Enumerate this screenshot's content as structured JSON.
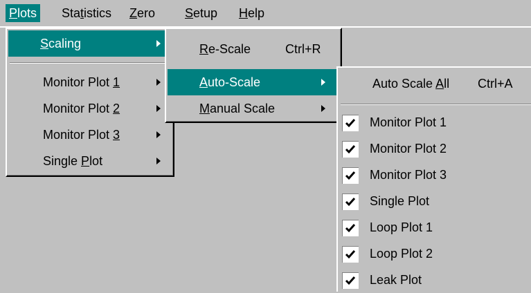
{
  "menubar": {
    "items": [
      {
        "pre": "",
        "acc": "P",
        "post": "lots"
      },
      {
        "pre": "Sta",
        "acc": "t",
        "post": "istics"
      },
      {
        "pre": "",
        "acc": "Z",
        "post": "ero"
      },
      {
        "pre": "",
        "acc": "S",
        "post": "etup"
      },
      {
        "pre": "",
        "acc": "H",
        "post": "elp"
      }
    ]
  },
  "plots_menu": {
    "scaling": {
      "pre": "",
      "acc": "S",
      "post": "caling"
    },
    "items": [
      {
        "pre": "Monitor Plot ",
        "acc": "1",
        "post": ""
      },
      {
        "pre": "Monitor Plot ",
        "acc": "2",
        "post": ""
      },
      {
        "pre": "Monitor Plot ",
        "acc": "3",
        "post": ""
      },
      {
        "pre": "Single ",
        "acc": "P",
        "post": "lot"
      }
    ]
  },
  "scaling_menu": {
    "rescale": {
      "pre": "",
      "acc": "R",
      "post": "e-Scale",
      "shortcut": "Ctrl+R"
    },
    "autoscale": {
      "pre": "",
      "acc": "A",
      "post": "uto-Scale"
    },
    "manualscale": {
      "pre": "",
      "acc": "M",
      "post": "anual Scale"
    }
  },
  "autoscale_menu": {
    "all": {
      "pre": "Auto Scale ",
      "acc": "A",
      "post": "ll",
      "shortcut": "Ctrl+A"
    },
    "items": [
      {
        "label": "Monitor Plot 1",
        "checked": true
      },
      {
        "label": "Monitor Plot 2",
        "checked": true
      },
      {
        "label": "Monitor Plot 3",
        "checked": true
      },
      {
        "label": "Single Plot",
        "checked": true
      },
      {
        "label": "Loop Plot 1",
        "checked": true
      },
      {
        "label": "Loop Plot 2",
        "checked": true
      },
      {
        "label": "Leak Plot",
        "checked": true
      }
    ]
  }
}
